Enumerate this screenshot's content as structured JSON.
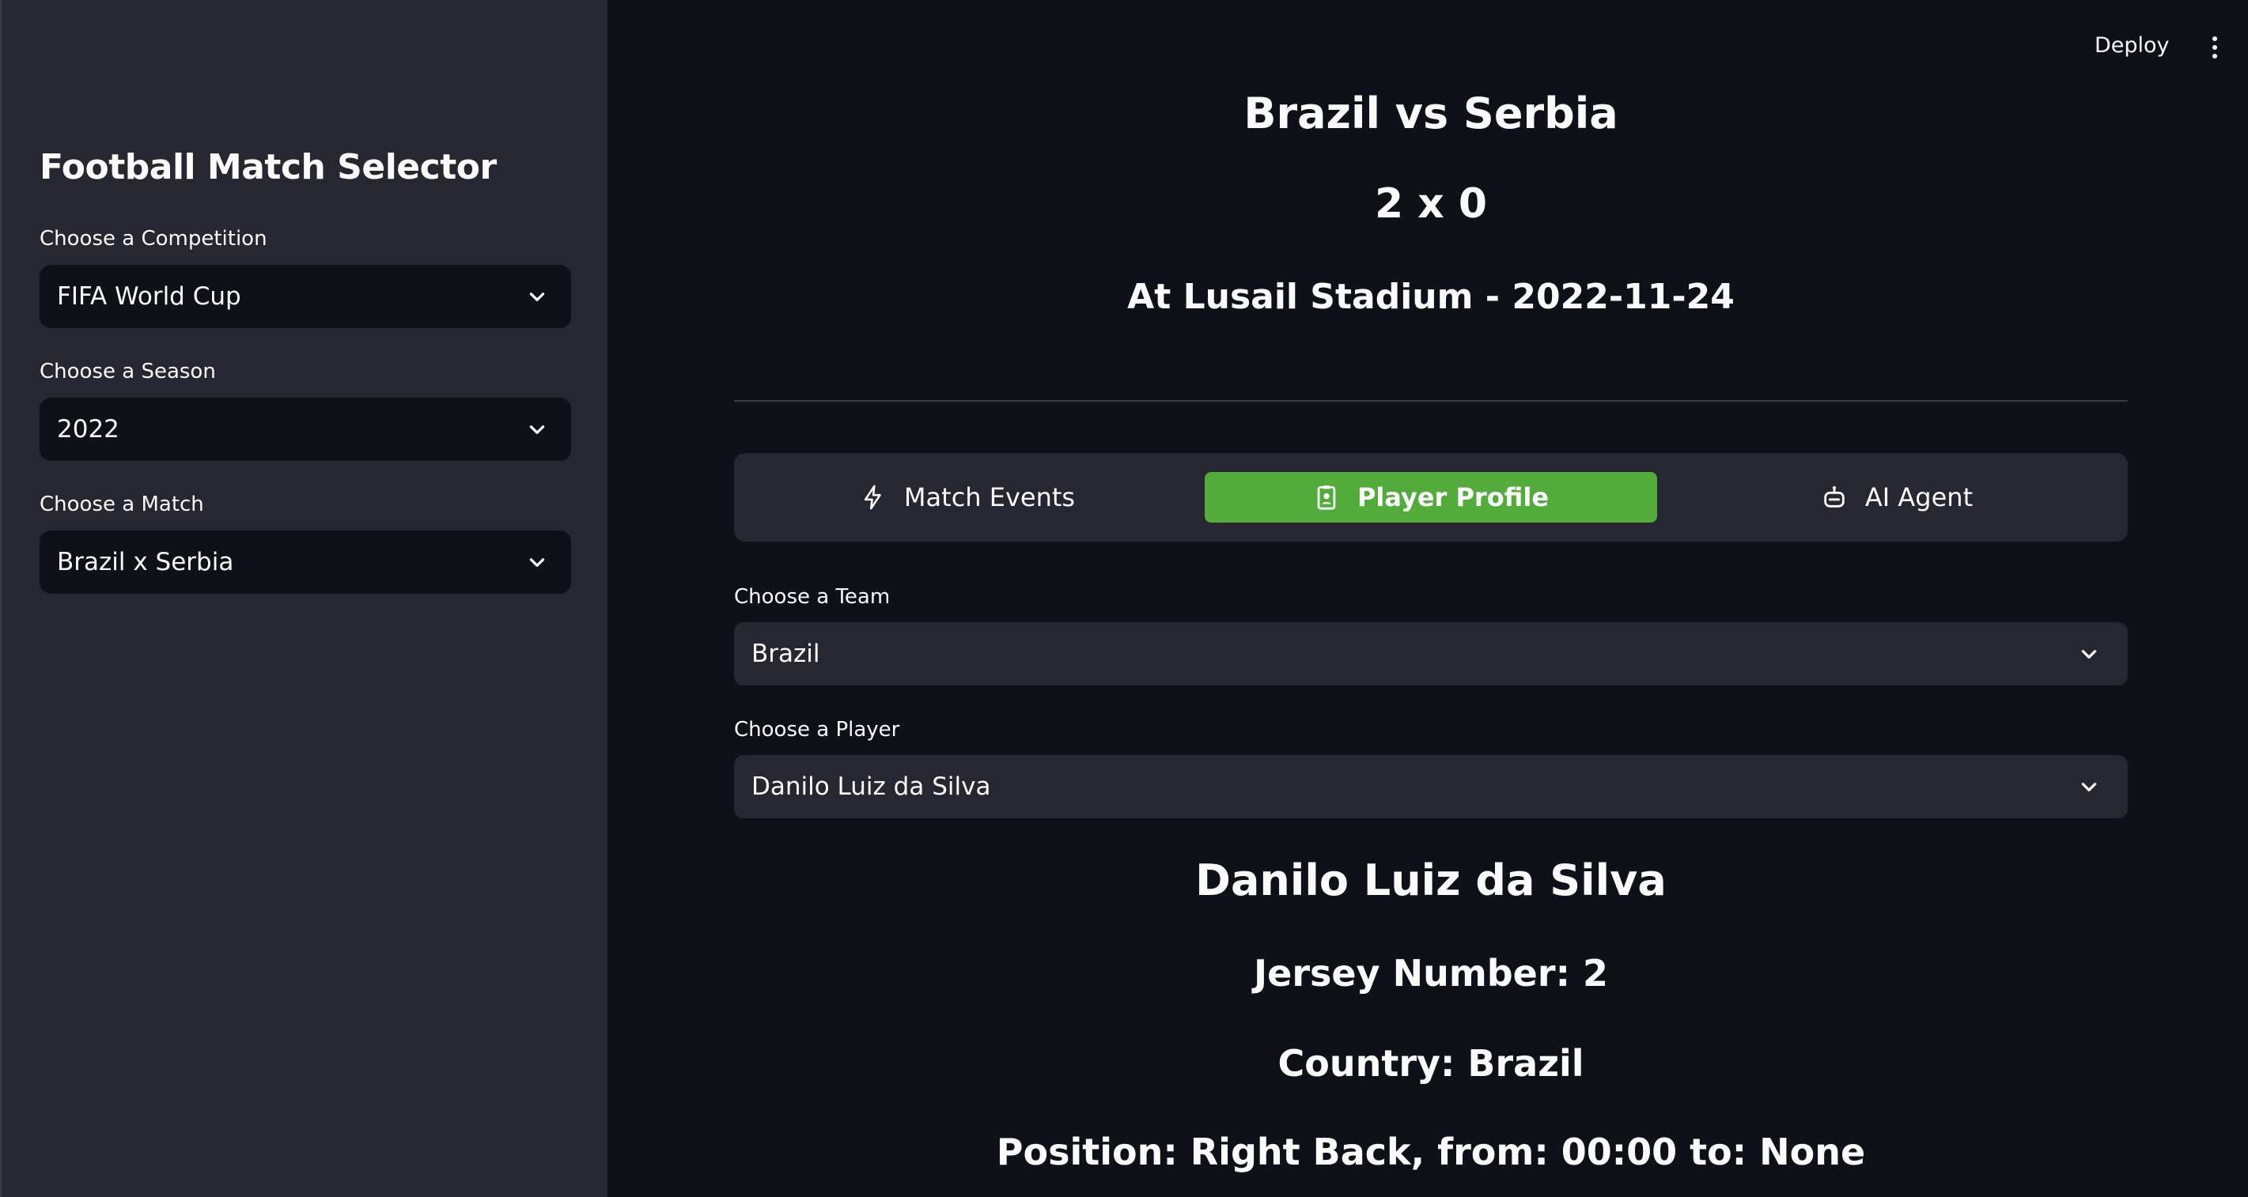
{
  "header": {
    "deploy_label": "Deploy",
    "menu_icon": "kebab-menu-icon"
  },
  "sidebar": {
    "title": "Football Match Selector",
    "competition": {
      "label": "Choose a Competition",
      "value": "FIFA World Cup"
    },
    "season": {
      "label": "Choose a Season",
      "value": "2022"
    },
    "match": {
      "label": "Choose a Match",
      "value": "Brazil x Serbia"
    }
  },
  "match": {
    "title": "Brazil vs Serbia",
    "score": "2 x 0",
    "venue": "At Lusail Stadium - 2022-11-24"
  },
  "tabs": [
    {
      "label": "Match Events",
      "icon": "lightning-icon",
      "active": false
    },
    {
      "label": "Player Profile",
      "icon": "id-badge-icon",
      "active": true
    },
    {
      "label": "AI Agent",
      "icon": "robot-icon",
      "active": false
    }
  ],
  "team_select": {
    "label": "Choose a Team",
    "value": "Brazil"
  },
  "player_select": {
    "label": "Choose a Player",
    "value": "Danilo Luiz da Silva"
  },
  "player": {
    "name": "Danilo Luiz da Silva",
    "jersey": "Jersey Number: 2",
    "country": "Country: Brazil",
    "position": "Position: Right Back, from: 00:00 to: None"
  },
  "colors": {
    "background": "#0e1117",
    "sidebar": "#262730",
    "accent": "#53ab3b",
    "text": "#fafafa"
  }
}
